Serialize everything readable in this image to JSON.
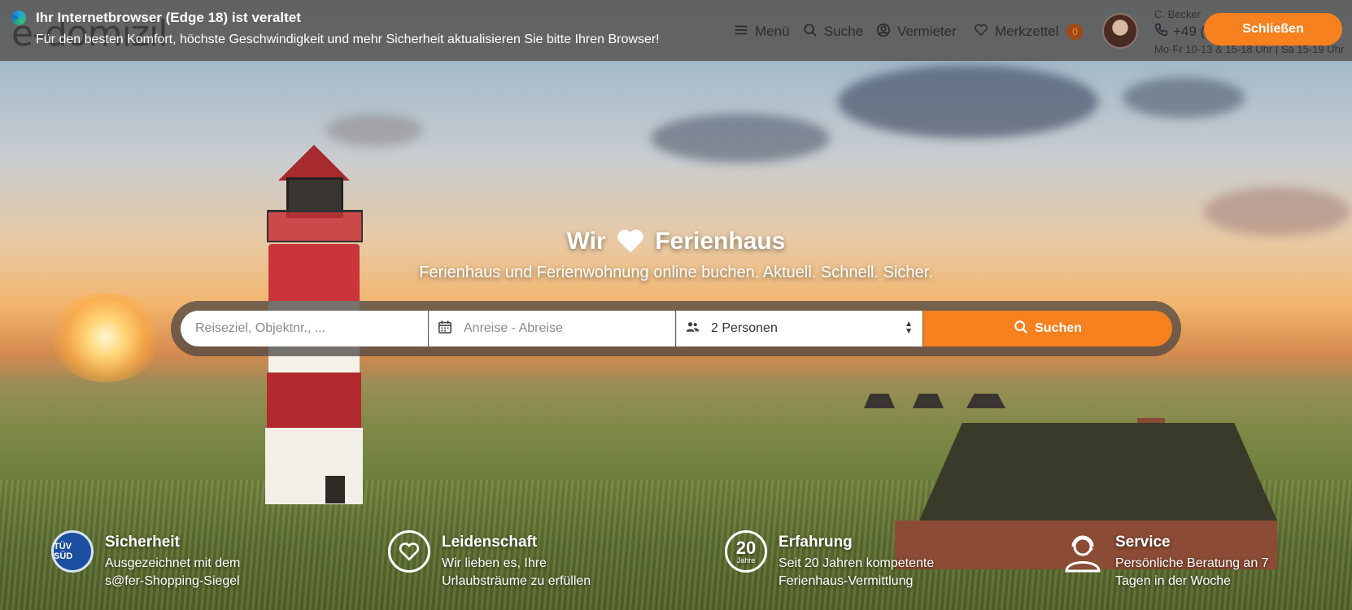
{
  "notification": {
    "title": "Ihr Internetbrowser (Edge 18) ist veraltet",
    "text": "Für den besten Komfort, höchste Geschwindigkeit und mehr Sicherheit aktualisieren Sie bitte Ihren Browser!",
    "close_label": "Schließen",
    "icon": "edge-browser-icon"
  },
  "header": {
    "logo_text": "e-domizil",
    "nav": [
      {
        "label": "Menü",
        "icon": "menu-icon"
      },
      {
        "label": "Suche",
        "icon": "search-icon"
      },
      {
        "label": "Vermieter",
        "icon": "user-icon"
      },
      {
        "label": "Merkzettel",
        "icon": "heart-icon",
        "badge": "0"
      }
    ],
    "contact": {
      "name": "C. Becker",
      "phone": "+49 (",
      "hours": "Mo-Fr 10-13 & 15-18 Uhr | Sa 15-19 Uhr"
    }
  },
  "hero": {
    "headline_pre": "Wir",
    "headline_post": "Ferienhaus",
    "subline": "Ferienhaus und Ferienwohnung online buchen. Aktuell. Schnell. Sicher."
  },
  "search": {
    "destination_placeholder": "Reiseziel, Objektnr., ...",
    "dates_placeholder": "Anreise - Abreise",
    "persons_value": "2 Personen",
    "button_label": "Suchen"
  },
  "features": [
    {
      "title": "Sicherheit",
      "desc1": "Ausgezeichnet mit dem",
      "desc2": "s@fer-Shopping-Siegel",
      "badge_text": "TÜV SÜD"
    },
    {
      "title": "Leidenschaft",
      "desc1": "Wir lieben es, Ihre",
      "desc2": "Urlaubsträume zu erfüllen"
    },
    {
      "title": "Erfahrung",
      "desc1": "Seit 20 Jahren kompetente",
      "desc2": "Ferienhaus-Vermittlung",
      "badge_number": "20",
      "badge_unit": "Jahre"
    },
    {
      "title": "Service",
      "desc1": "Persönliche Beratung an 7",
      "desc2": "Tagen in der Woche"
    }
  ],
  "colors": {
    "accent": "#f7801f",
    "notification_bg": "#606060"
  }
}
